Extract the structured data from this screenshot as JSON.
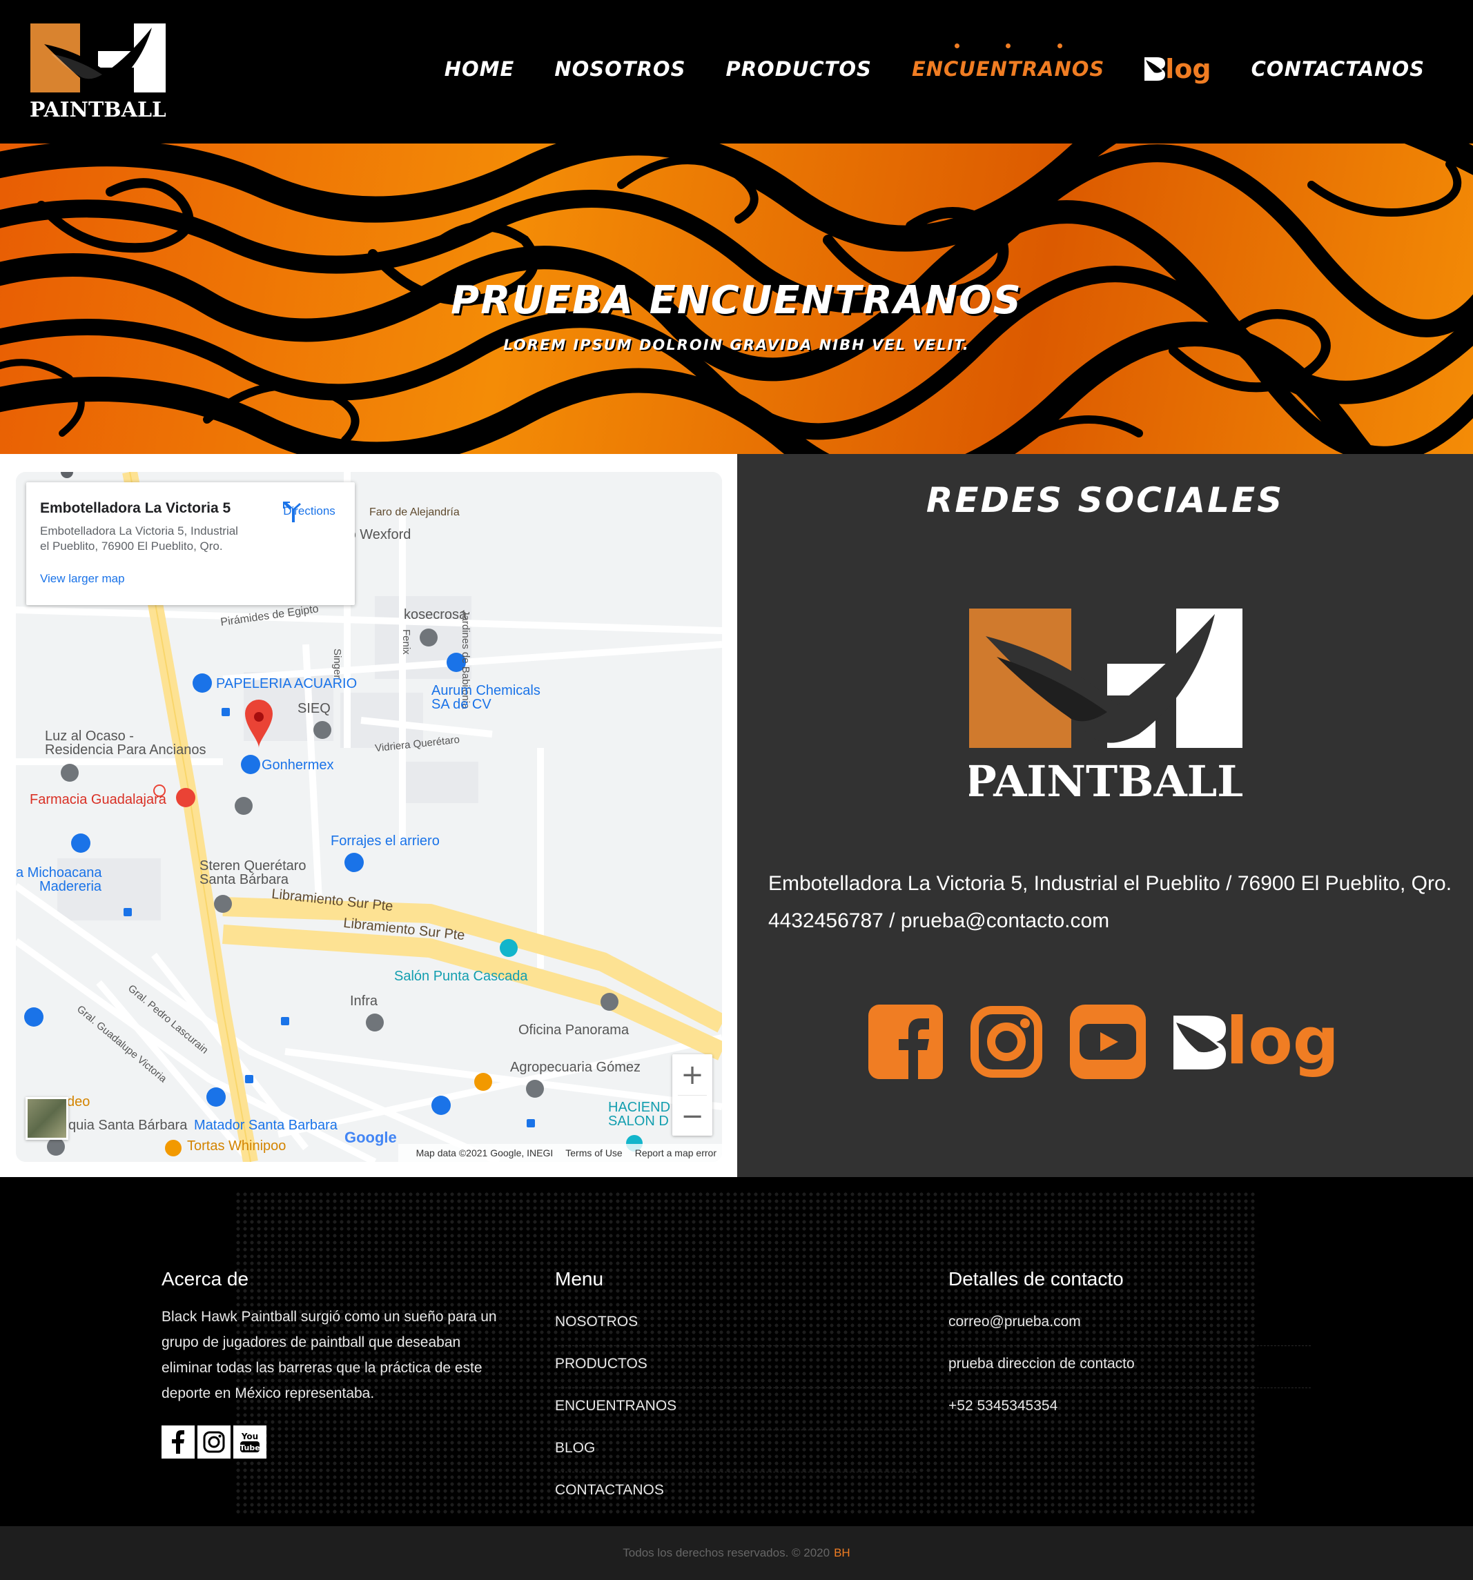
{
  "brand": {
    "logo_letters": "BH",
    "logo_text": "PAINTBALL",
    "primary_color": "#f07d23",
    "dark_color": "#000000"
  },
  "nav": {
    "items": [
      {
        "label": "HOME",
        "active": false
      },
      {
        "label": "NOSOTROS",
        "active": false
      },
      {
        "label": "PRODUCTOS",
        "active": false
      },
      {
        "label": "ENCUENTRANOS",
        "active": true
      }
    ],
    "blog_label": "log",
    "contact_label": "CONTACTANOS"
  },
  "hero": {
    "title": "PRUEBA ENCUENTRANOS",
    "subtitle": "LOREM IPSUM DOLROIN GRAVIDA NIBH VEL VELIT."
  },
  "map": {
    "card": {
      "title": "Embotelladora La Victoria 5",
      "address": "Embotelladora La Victoria 5, Industrial el Pueblito, 76900 El Pueblito, Qro.",
      "larger_map": "View larger map",
      "directions": "Directions"
    },
    "places": [
      {
        "name": "Faro de Alejandría",
        "style": "brown"
      },
      {
        "name": "gio Wexford",
        "style": "grey"
      },
      {
        "name": "Jardines de Babilonia",
        "style": "grey"
      },
      {
        "name": "Pirámides de Egipto",
        "style": "grey"
      },
      {
        "name": "kosecrosa",
        "style": "grey"
      },
      {
        "name": "Singer",
        "style": "grey"
      },
      {
        "name": "Fenix",
        "style": "grey"
      },
      {
        "name": "PAPELERIA ACUARIO",
        "style": "blue"
      },
      {
        "name": "Aurum Chemicals",
        "style": "blue"
      },
      {
        "name": "SA de CV",
        "style": "blue"
      },
      {
        "name": "SIEQ",
        "style": "grey"
      },
      {
        "name": "Luz al Ocaso -",
        "style": "grey"
      },
      {
        "name": "Residencia Para Ancianos",
        "style": "grey"
      },
      {
        "name": "Vidriera Querétaro",
        "style": "grey"
      },
      {
        "name": "Gonhermex",
        "style": "blue"
      },
      {
        "name": "Farmacia Guadalajara",
        "style": "red"
      },
      {
        "name": "Forrajes el arriero",
        "style": "blue"
      },
      {
        "name": "a Michoacana",
        "style": "blue"
      },
      {
        "name": "Madereria",
        "style": "blue"
      },
      {
        "name": "Steren Querétaro",
        "style": "grey"
      },
      {
        "name": "Santa Bárbara",
        "style": "grey"
      },
      {
        "name": "Libramiento Sur Pte",
        "style": "brown"
      },
      {
        "name": "Libramiento Sur Pte",
        "style": "brown"
      },
      {
        "name": "Salón Punta Cascada",
        "style": "teal"
      },
      {
        "name": "Infra",
        "style": "grey"
      },
      {
        "name": "Oficina Panorama",
        "style": "grey"
      },
      {
        "name": "Gral. Pedro Lascurain",
        "style": "grey"
      },
      {
        "name": "Gral. Guadalupe Victoria",
        "style": "grey"
      },
      {
        "name": "Agropecuaria Gómez",
        "style": "grey"
      },
      {
        "name": "HACIEND",
        "style": "teal"
      },
      {
        "name": "SALON D",
        "style": "teal"
      },
      {
        "name": "quia Santa Bárbara",
        "style": "grey"
      },
      {
        "name": "Matador Santa Barbara",
        "style": "blue"
      },
      {
        "name": "Tortas Whinipoo",
        "style": "brown"
      },
      {
        "name": "deo",
        "style": "brown"
      }
    ],
    "google": "Google",
    "footer": {
      "data": "Map data ©2021 Google, INEGI",
      "terms": "Terms of Use",
      "report": "Report a map error"
    },
    "zoom_in": "+",
    "zoom_out": "−"
  },
  "social": {
    "title": "REDES SOCIALES",
    "address": "Embotelladora La Victoria 5, Industrial el Pueblito / 76900 El Pueblito, Qro.",
    "contact": "4432456787 / prueba@contacto.com",
    "blog_label": "log",
    "icons": [
      "facebook-icon",
      "instagram-icon",
      "youtube-icon",
      "blog-icon"
    ]
  },
  "footer": {
    "about": {
      "heading": "Acerca de",
      "text": "Black Hawk Paintball surgió como un sueño para un grupo de jugadores de paintball que deseaban eliminar todas las barreras que la práctica de este deporte en México representaba.",
      "youtube_short": "You Tube"
    },
    "menu": {
      "heading": "Menu",
      "items": [
        "NOSOTROS",
        "PRODUCTOS",
        "ENCUENTRANOS",
        "BLOG",
        "CONTACTANOS"
      ]
    },
    "contact": {
      "heading": "Detalles de contacto",
      "items": [
        "correo@prueba.com",
        "prueba direccion de contacto",
        "+52 5345345354"
      ]
    },
    "copyright": "Todos los derechos reservados. © 2020",
    "copyright_brand": "BH"
  }
}
